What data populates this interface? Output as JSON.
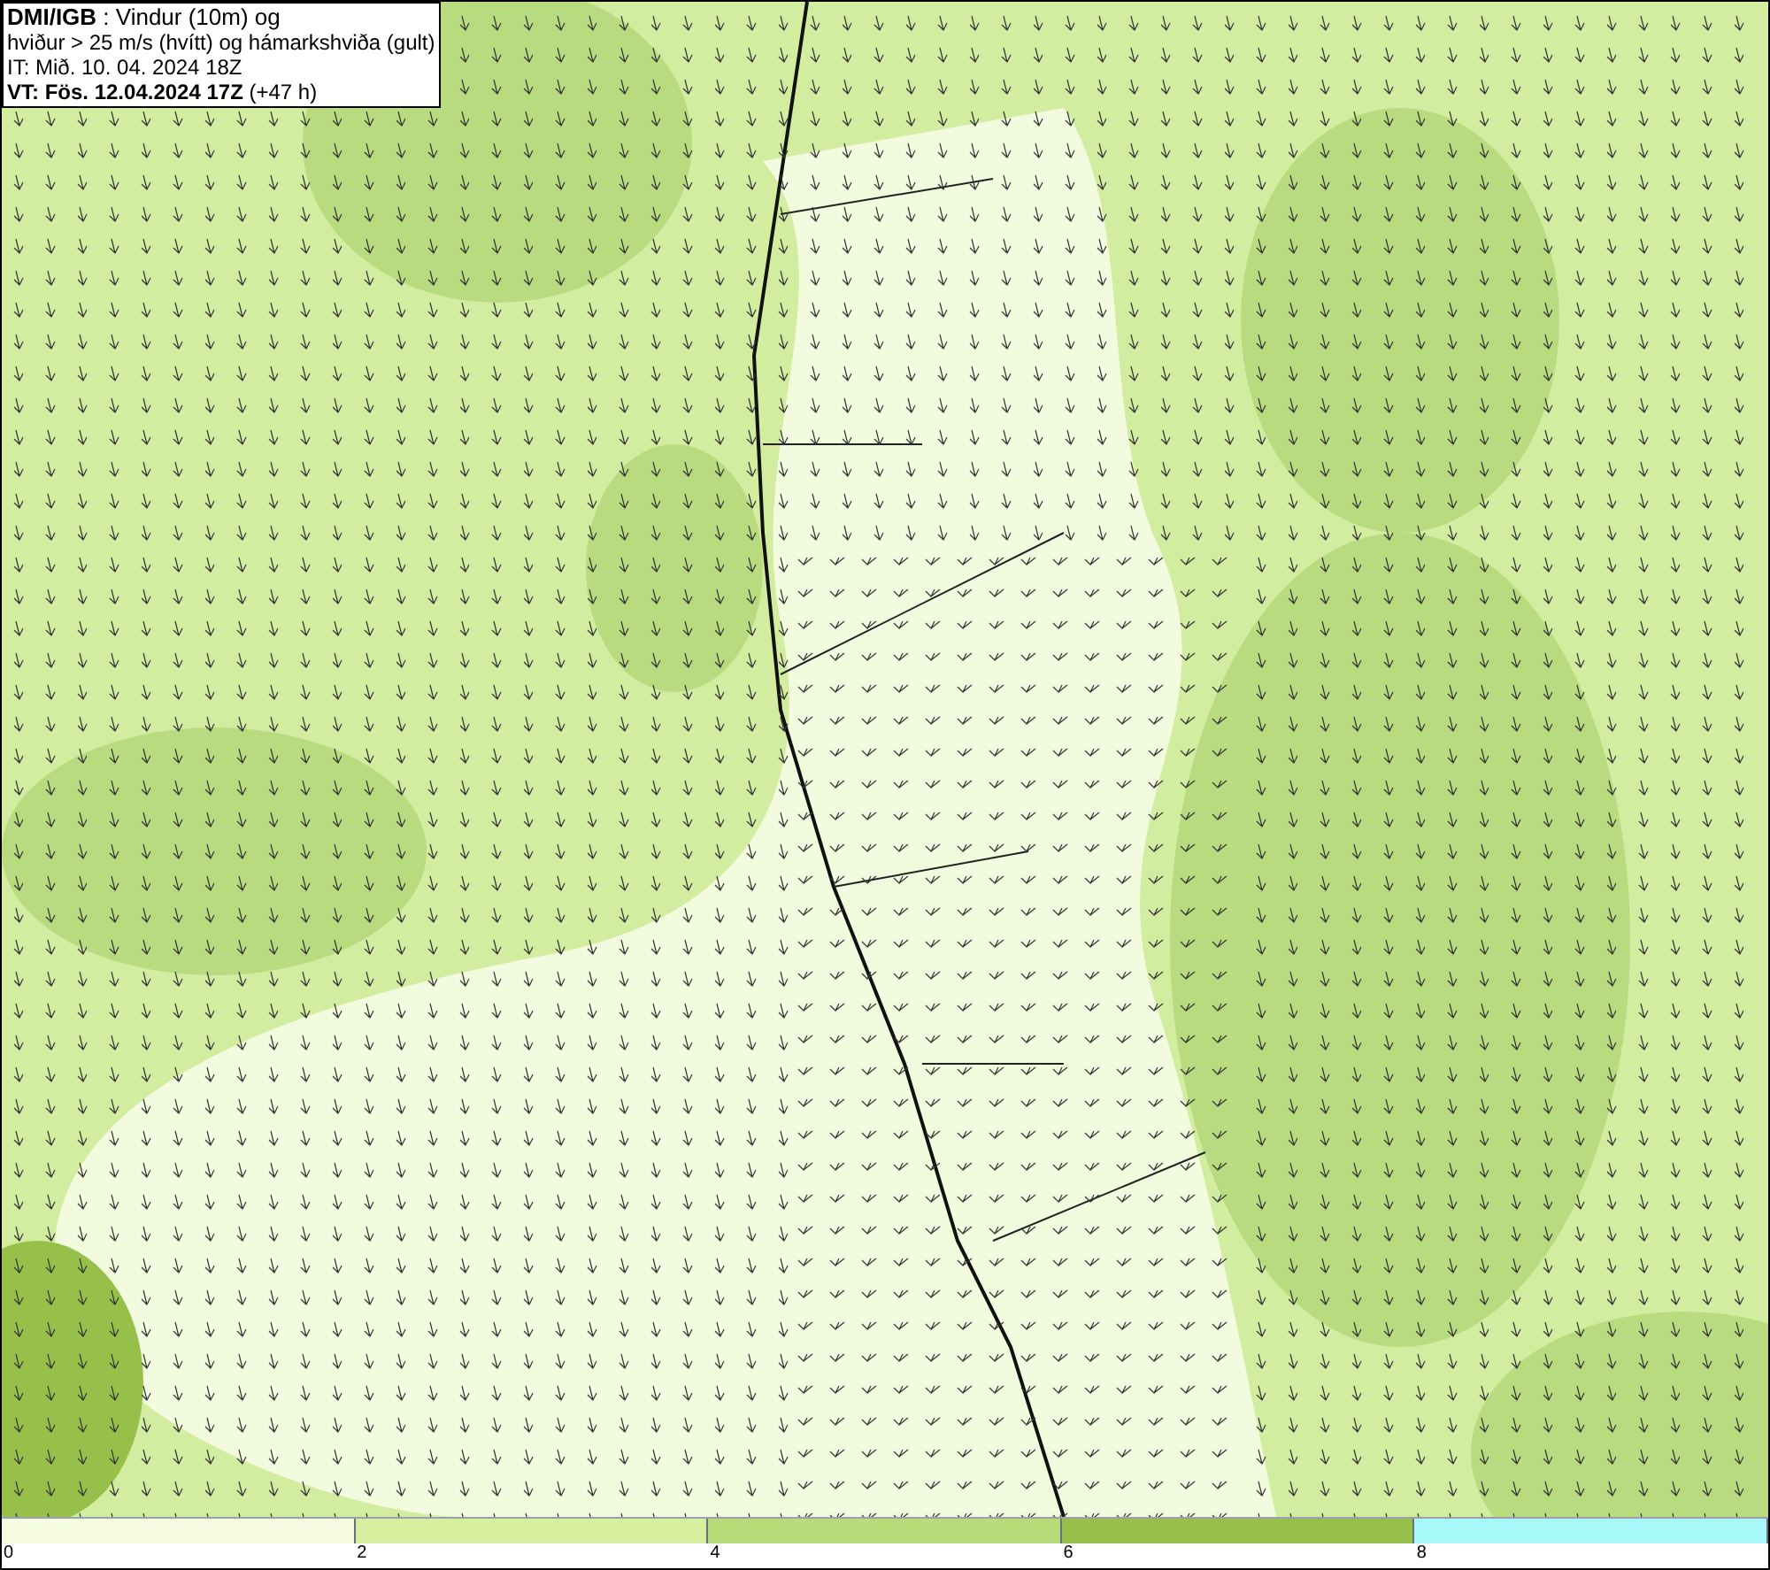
{
  "title_box": {
    "lines": [
      "**DMI/IGB** : Vindur (10m) og",
      "hviður > 25 m/s (hvítt) og hámarkshviða (gult)",
      "IT: Mið. 10. 04. 2024 18Z",
      "**VT: Fös. 12.04.2024 17Z** (+47 h)"
    ]
  },
  "colorbar": {
    "segments": [
      {
        "color": "#f5fce0"
      },
      {
        "color": "#d6f0a0"
      },
      {
        "color": "#b5dc78"
      },
      {
        "color": "#96c04a"
      },
      {
        "color": "#a8fafa"
      }
    ],
    "ticks": [
      "0",
      "2",
      "4",
      "6",
      "8"
    ]
  }
}
